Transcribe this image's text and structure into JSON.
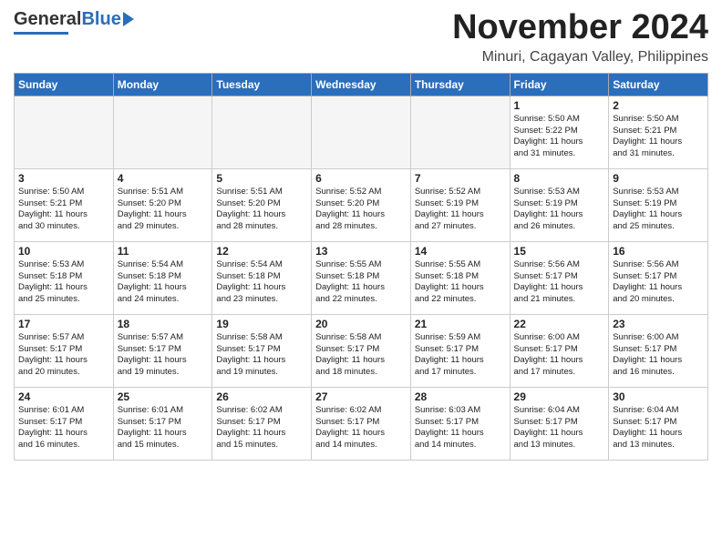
{
  "header": {
    "logo_general": "General",
    "logo_blue": "Blue",
    "month_title": "November 2024",
    "location": "Minuri, Cagayan Valley, Philippines"
  },
  "weekdays": [
    "Sunday",
    "Monday",
    "Tuesday",
    "Wednesday",
    "Thursday",
    "Friday",
    "Saturday"
  ],
  "weeks": [
    [
      {
        "day": "",
        "info": ""
      },
      {
        "day": "",
        "info": ""
      },
      {
        "day": "",
        "info": ""
      },
      {
        "day": "",
        "info": ""
      },
      {
        "day": "",
        "info": ""
      },
      {
        "day": "1",
        "info": "Sunrise: 5:50 AM\nSunset: 5:22 PM\nDaylight: 11 hours\nand 31 minutes."
      },
      {
        "day": "2",
        "info": "Sunrise: 5:50 AM\nSunset: 5:21 PM\nDaylight: 11 hours\nand 31 minutes."
      }
    ],
    [
      {
        "day": "3",
        "info": "Sunrise: 5:50 AM\nSunset: 5:21 PM\nDaylight: 11 hours\nand 30 minutes."
      },
      {
        "day": "4",
        "info": "Sunrise: 5:51 AM\nSunset: 5:20 PM\nDaylight: 11 hours\nand 29 minutes."
      },
      {
        "day": "5",
        "info": "Sunrise: 5:51 AM\nSunset: 5:20 PM\nDaylight: 11 hours\nand 28 minutes."
      },
      {
        "day": "6",
        "info": "Sunrise: 5:52 AM\nSunset: 5:20 PM\nDaylight: 11 hours\nand 28 minutes."
      },
      {
        "day": "7",
        "info": "Sunrise: 5:52 AM\nSunset: 5:19 PM\nDaylight: 11 hours\nand 27 minutes."
      },
      {
        "day": "8",
        "info": "Sunrise: 5:53 AM\nSunset: 5:19 PM\nDaylight: 11 hours\nand 26 minutes."
      },
      {
        "day": "9",
        "info": "Sunrise: 5:53 AM\nSunset: 5:19 PM\nDaylight: 11 hours\nand 25 minutes."
      }
    ],
    [
      {
        "day": "10",
        "info": "Sunrise: 5:53 AM\nSunset: 5:18 PM\nDaylight: 11 hours\nand 25 minutes."
      },
      {
        "day": "11",
        "info": "Sunrise: 5:54 AM\nSunset: 5:18 PM\nDaylight: 11 hours\nand 24 minutes."
      },
      {
        "day": "12",
        "info": "Sunrise: 5:54 AM\nSunset: 5:18 PM\nDaylight: 11 hours\nand 23 minutes."
      },
      {
        "day": "13",
        "info": "Sunrise: 5:55 AM\nSunset: 5:18 PM\nDaylight: 11 hours\nand 22 minutes."
      },
      {
        "day": "14",
        "info": "Sunrise: 5:55 AM\nSunset: 5:18 PM\nDaylight: 11 hours\nand 22 minutes."
      },
      {
        "day": "15",
        "info": "Sunrise: 5:56 AM\nSunset: 5:17 PM\nDaylight: 11 hours\nand 21 minutes."
      },
      {
        "day": "16",
        "info": "Sunrise: 5:56 AM\nSunset: 5:17 PM\nDaylight: 11 hours\nand 20 minutes."
      }
    ],
    [
      {
        "day": "17",
        "info": "Sunrise: 5:57 AM\nSunset: 5:17 PM\nDaylight: 11 hours\nand 20 minutes."
      },
      {
        "day": "18",
        "info": "Sunrise: 5:57 AM\nSunset: 5:17 PM\nDaylight: 11 hours\nand 19 minutes."
      },
      {
        "day": "19",
        "info": "Sunrise: 5:58 AM\nSunset: 5:17 PM\nDaylight: 11 hours\nand 19 minutes."
      },
      {
        "day": "20",
        "info": "Sunrise: 5:58 AM\nSunset: 5:17 PM\nDaylight: 11 hours\nand 18 minutes."
      },
      {
        "day": "21",
        "info": "Sunrise: 5:59 AM\nSunset: 5:17 PM\nDaylight: 11 hours\nand 17 minutes."
      },
      {
        "day": "22",
        "info": "Sunrise: 6:00 AM\nSunset: 5:17 PM\nDaylight: 11 hours\nand 17 minutes."
      },
      {
        "day": "23",
        "info": "Sunrise: 6:00 AM\nSunset: 5:17 PM\nDaylight: 11 hours\nand 16 minutes."
      }
    ],
    [
      {
        "day": "24",
        "info": "Sunrise: 6:01 AM\nSunset: 5:17 PM\nDaylight: 11 hours\nand 16 minutes."
      },
      {
        "day": "25",
        "info": "Sunrise: 6:01 AM\nSunset: 5:17 PM\nDaylight: 11 hours\nand 15 minutes."
      },
      {
        "day": "26",
        "info": "Sunrise: 6:02 AM\nSunset: 5:17 PM\nDaylight: 11 hours\nand 15 minutes."
      },
      {
        "day": "27",
        "info": "Sunrise: 6:02 AM\nSunset: 5:17 PM\nDaylight: 11 hours\nand 14 minutes."
      },
      {
        "day": "28",
        "info": "Sunrise: 6:03 AM\nSunset: 5:17 PM\nDaylight: 11 hours\nand 14 minutes."
      },
      {
        "day": "29",
        "info": "Sunrise: 6:04 AM\nSunset: 5:17 PM\nDaylight: 11 hours\nand 13 minutes."
      },
      {
        "day": "30",
        "info": "Sunrise: 6:04 AM\nSunset: 5:17 PM\nDaylight: 11 hours\nand 13 minutes."
      }
    ]
  ]
}
